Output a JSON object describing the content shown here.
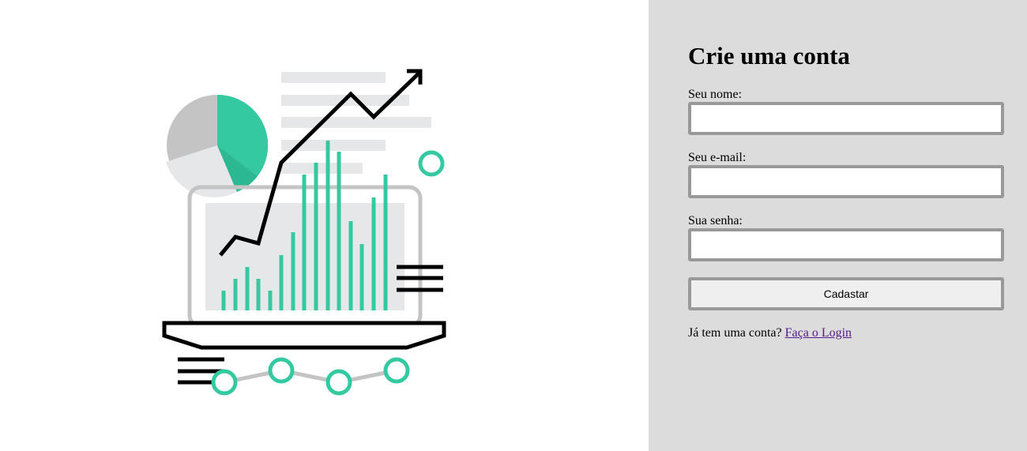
{
  "illustration": {
    "accent_color": "#35c9a2",
    "accent_dark_color": "#2bb892",
    "line_color": "#000000",
    "panel_gray": "#c4c4c4",
    "light_gray": "#e6e7e8",
    "icon": "analytics-laptop-illustration"
  },
  "form": {
    "title": "Crie uma conta",
    "name_label": "Seu nome:",
    "name_value": "",
    "email_label": "Seu e-mail:",
    "email_value": "",
    "password_label": "Sua senha:",
    "password_value": "",
    "submit_label": "Cadastar",
    "login_prompt": "Já tem uma conta?",
    "login_link": "Faça o Login"
  },
  "colors": {
    "form_background": "#dcdcdc",
    "field_border": "#999999",
    "link_visited": "#551a8b"
  }
}
